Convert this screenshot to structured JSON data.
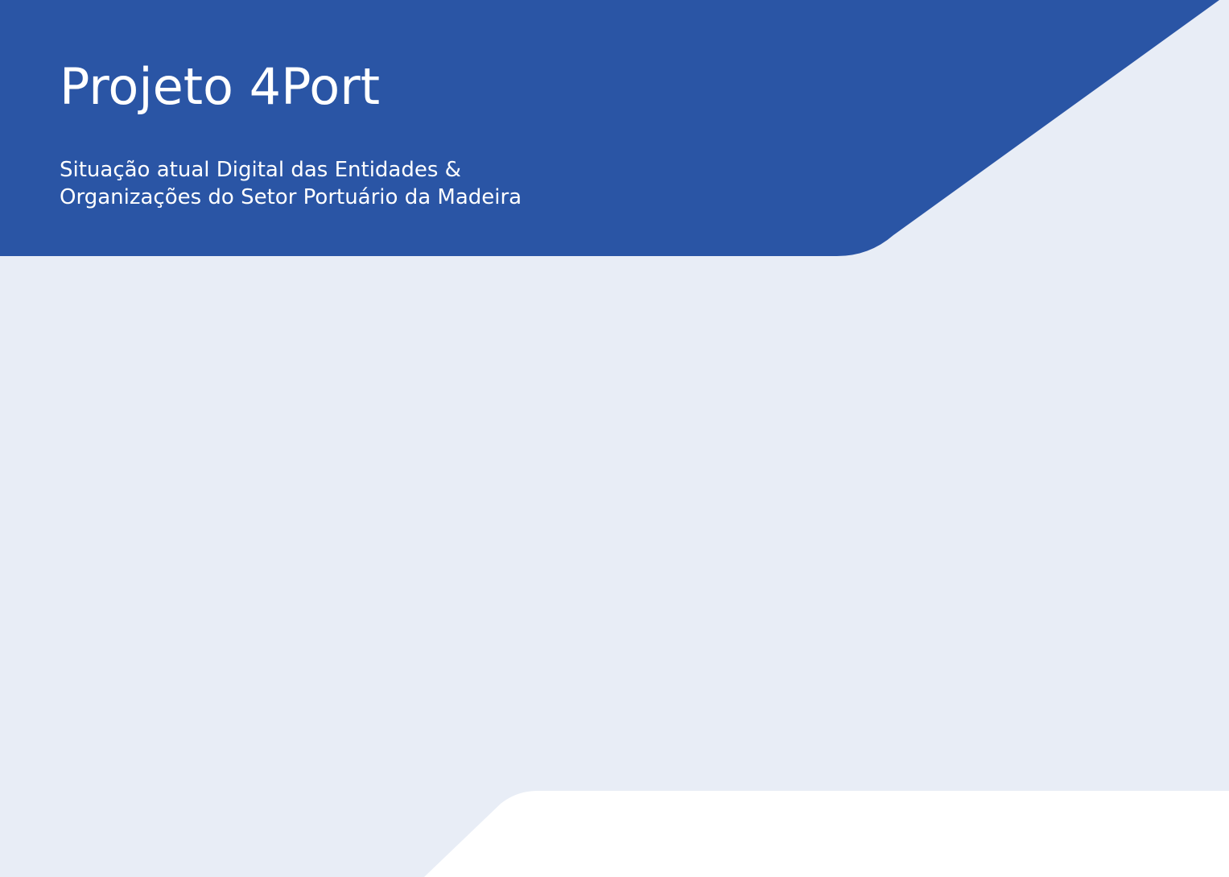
{
  "cover": {
    "title": "Projeto 4Port",
    "subtitle_lines": [
      "Situação atual Digital das Entidades &",
      "Organizações do Setor Portuário da Madeira"
    ]
  },
  "colors": {
    "header_blue": "#2A55A5",
    "panel_light": "#E8EDF6",
    "page_white": "#FFFFFF"
  }
}
